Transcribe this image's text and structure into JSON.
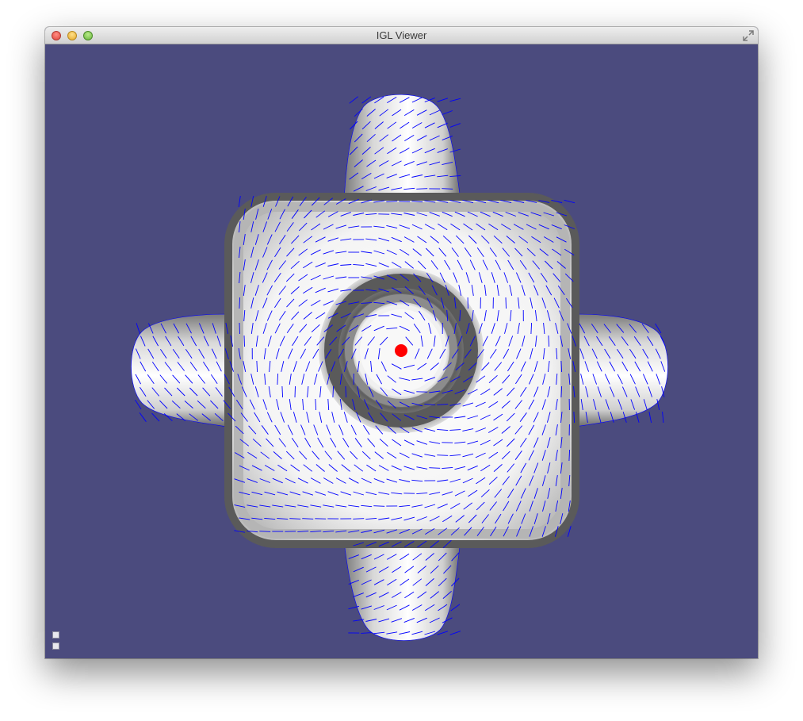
{
  "window": {
    "title": "IGL Viewer",
    "background_color": "#4b4b7e"
  },
  "icons": {
    "close": "close-button",
    "minimize": "minimize-button",
    "zoom": "zoom-button",
    "fullscreen": "fullscreen-arrows-icon",
    "panel_toggle_top": "panel-toggle-icon",
    "panel_toggle_bottom": "panel-toggle-icon"
  },
  "colors": {
    "mesh_light": "#ffffff",
    "mesh_shadow": "#6e6e6e",
    "vector_field": "#0000ff",
    "constraint_point": "#ff0000"
  }
}
